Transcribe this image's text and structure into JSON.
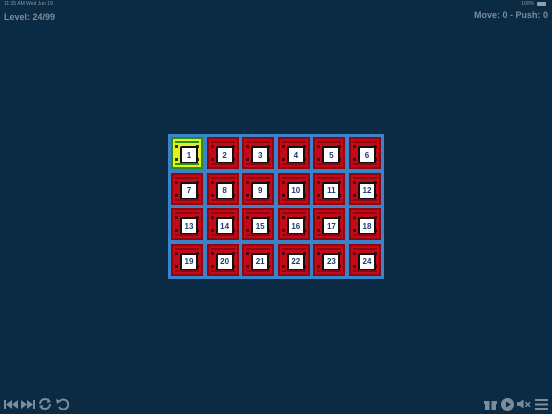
{
  "status_bar": {
    "left_text": "11:35 AM  Wed Jun 19",
    "right_text": "100%"
  },
  "header": {
    "level_text": "Level: 24/99",
    "moves_text": "Move: 0 - Push: 0"
  },
  "board": {
    "rows": 4,
    "cols": 6,
    "selected_cell": "1",
    "tiles": [
      "1",
      "2",
      "3",
      "4",
      "5",
      "6",
      "7",
      "8",
      "9",
      "10",
      "11",
      "12",
      "13",
      "14",
      "15",
      "16",
      "17",
      "18",
      "19",
      "20",
      "21",
      "22",
      "23",
      "24"
    ]
  },
  "toolbar": {
    "left_icons": [
      "skip-first-icon",
      "skip-last-icon",
      "shuffle-icon",
      "undo-icon"
    ],
    "right_icons": [
      "gift-icon",
      "play-icon",
      "mute-icon",
      "menu-icon"
    ]
  },
  "colors": {
    "background": "#0b2a43",
    "board_blue": "#3b82c8",
    "cell_red": "#c40a16",
    "selected_yellow": "#e8ef19",
    "tile_text": "#1f3a6b"
  }
}
